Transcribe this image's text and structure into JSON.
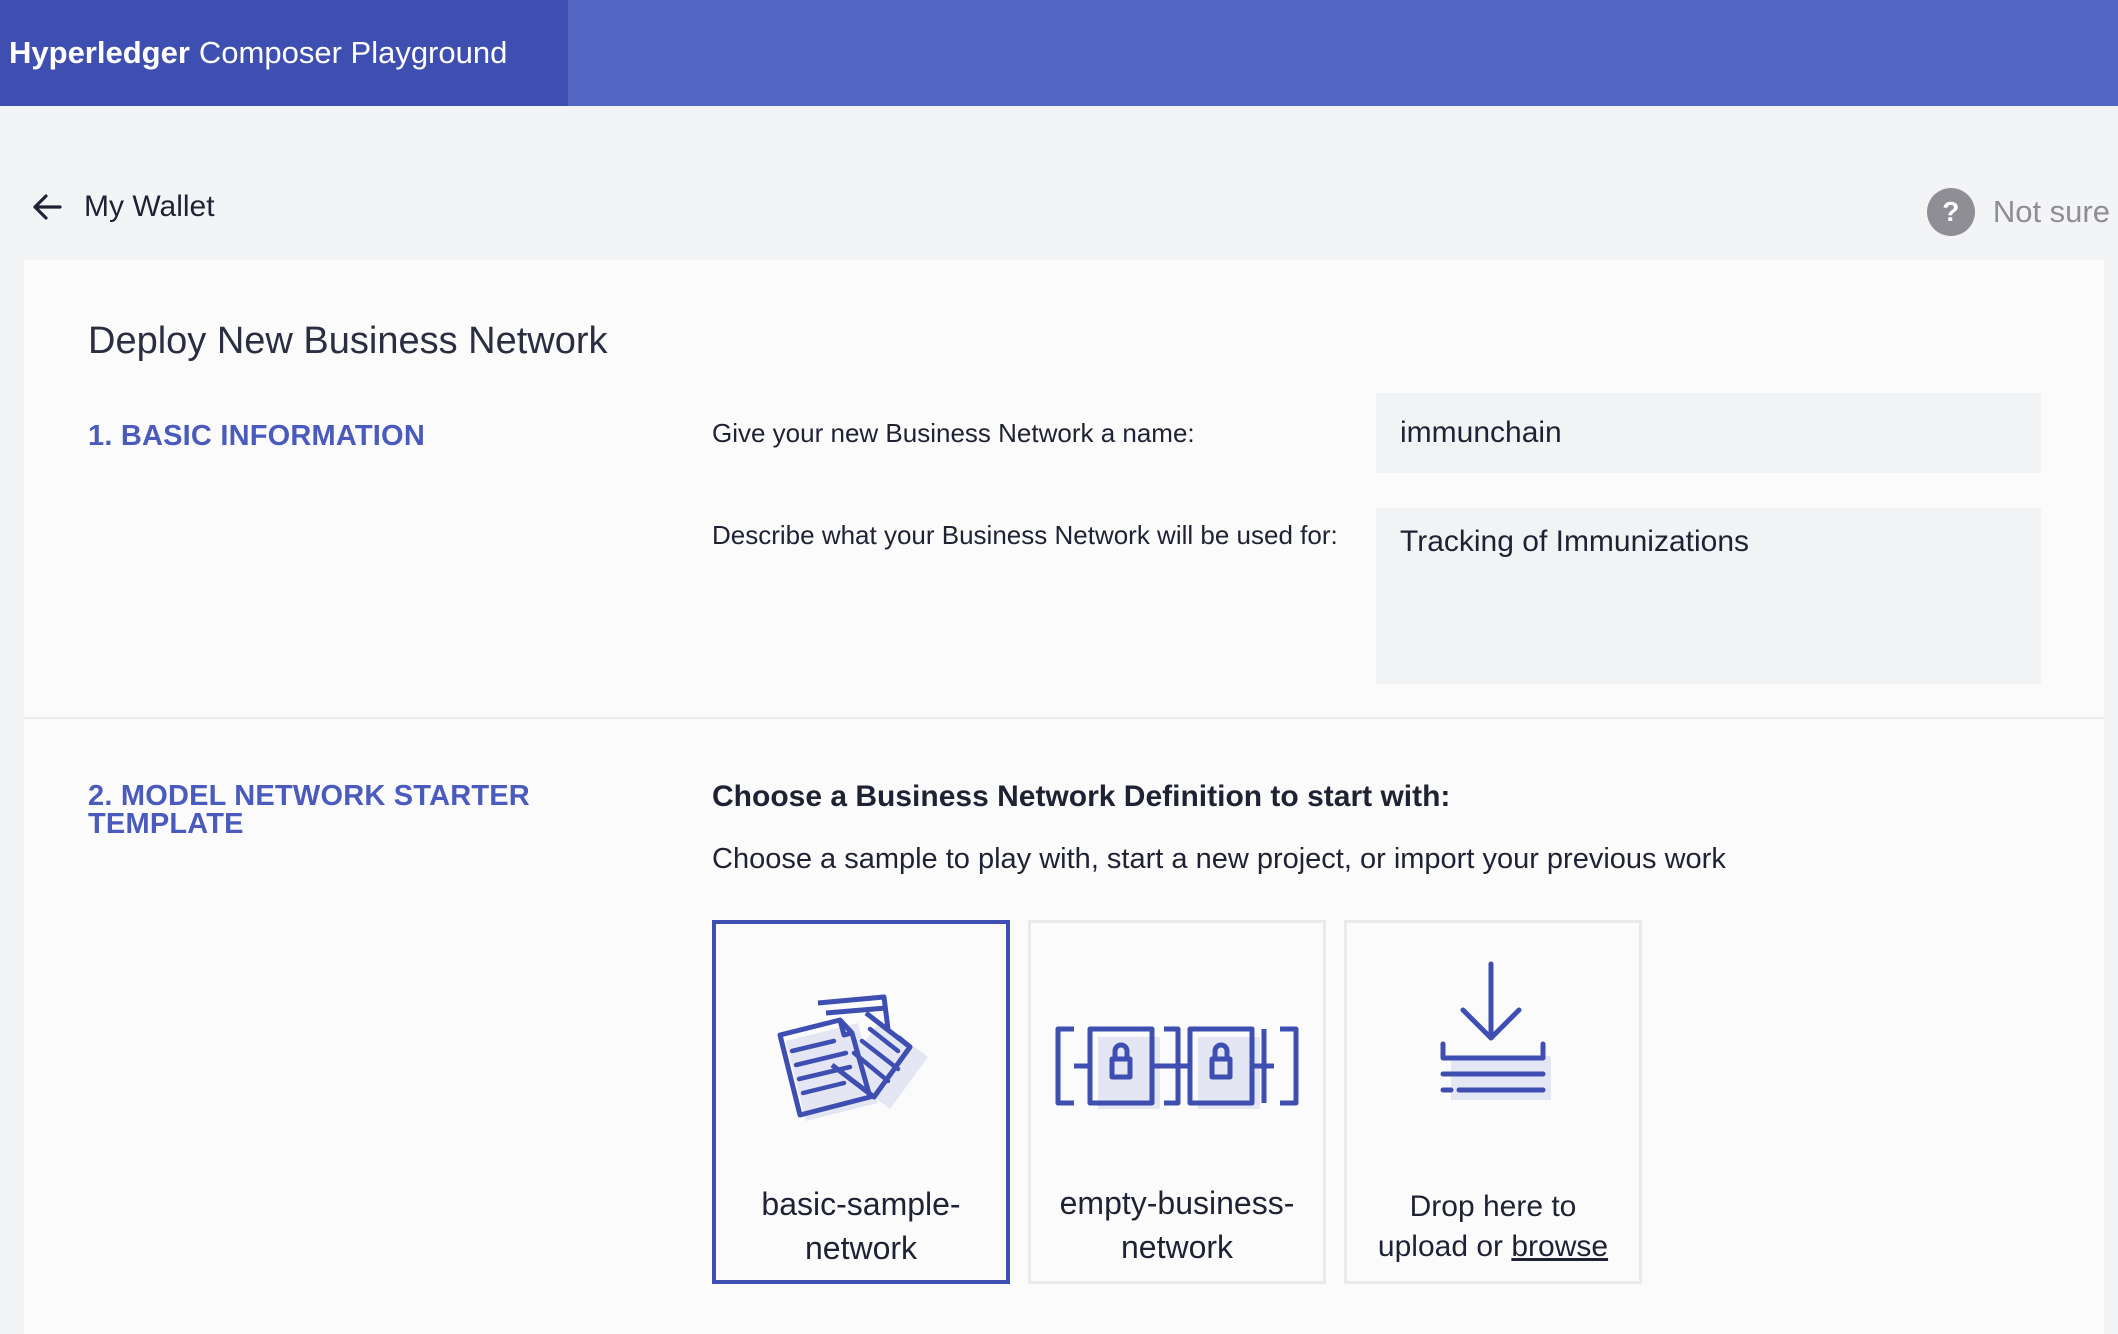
{
  "header": {
    "brand_bold": "Hyperledger",
    "brand_rest": "Composer Playground"
  },
  "subheader": {
    "back_label": "My Wallet",
    "help_icon": "?",
    "help_label": "Not sure"
  },
  "form": {
    "title": "Deploy New Business Network",
    "section1": "1. BASIC INFORMATION",
    "name_label": "Give your new Business Network a name:",
    "name_value": "immunchain",
    "desc_label": "Describe what your Business Network will be used for:",
    "desc_value": "Tracking of Immunizations",
    "section2_line1": "2. MODEL NETWORK STARTER",
    "section2_line2": "TEMPLATE",
    "choose_title": "Choose a Business Network Definition to start with:",
    "choose_sub": "Choose a sample to play with, start a new project, or import your previous work"
  },
  "templates": [
    {
      "line1": "basic-sample-",
      "line2": "network",
      "icon": "documents-icon",
      "selected": true
    },
    {
      "line1": "empty-business-",
      "line2": "network",
      "icon": "locked-blocks-icon",
      "selected": false
    },
    {
      "line1": "Drop here to",
      "line2_pre": "upload or ",
      "line2_link": "browse",
      "icon": "download-icon",
      "selected": false
    }
  ],
  "colors": {
    "topbar": "#5366c3",
    "brand_bg": "#3e4fb1",
    "accent": "#4a5bbd",
    "help_icon": "#8e8e94"
  }
}
